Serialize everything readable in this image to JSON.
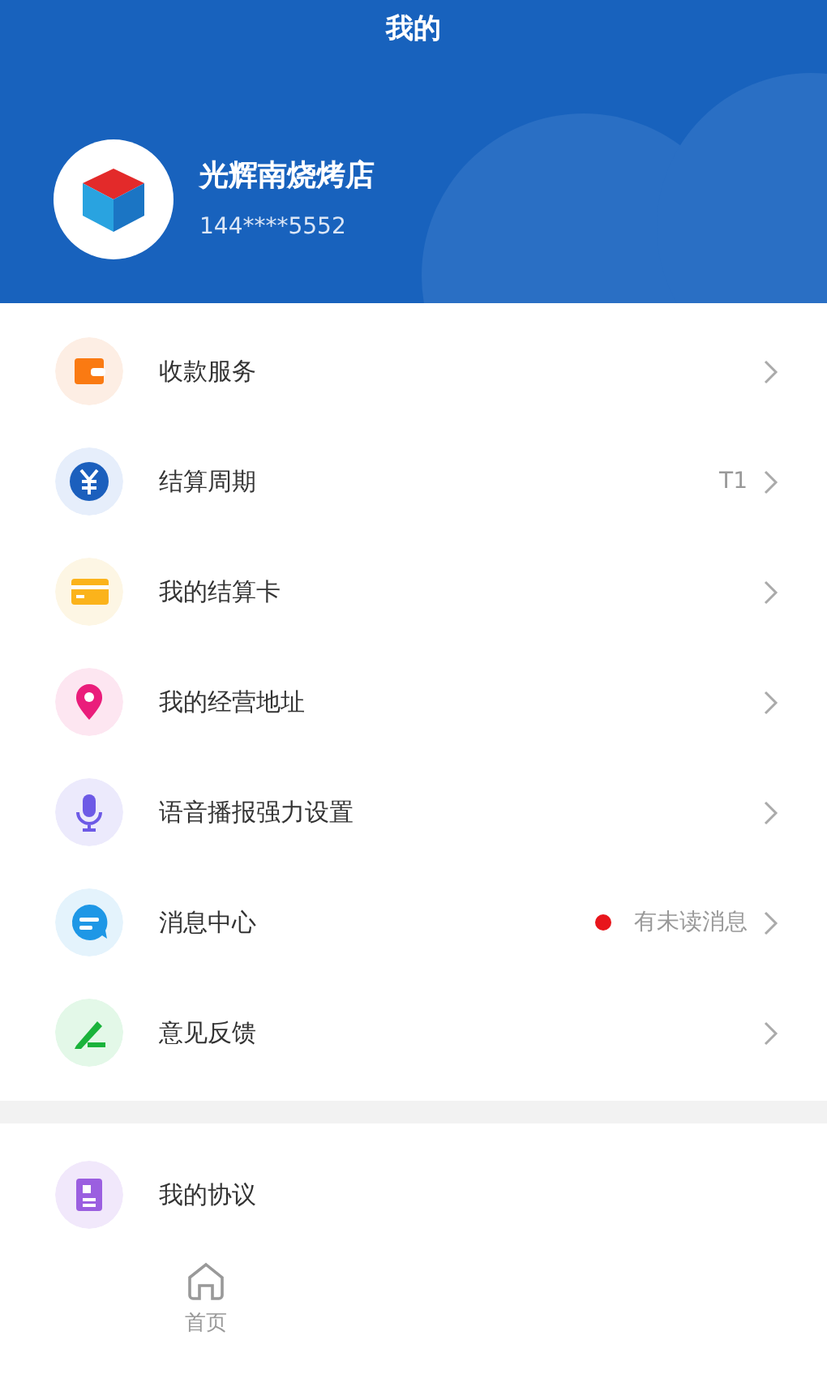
{
  "header": {
    "title": "我的",
    "store_name": "光辉南烧烤店",
    "phone": "144****5552"
  },
  "menu_groups": [
    {
      "items": [
        {
          "label": "收款服务"
        },
        {
          "label": "结算周期",
          "value": "T1"
        },
        {
          "label": "我的结算卡"
        },
        {
          "label": "我的经营地址"
        },
        {
          "label": "语音播报强力设置"
        },
        {
          "label": "消息中心",
          "unread": true,
          "value": "有未读消息"
        },
        {
          "label": "意见反馈"
        }
      ]
    },
    {
      "items": [
        {
          "label": "我的协议"
        }
      ]
    }
  ],
  "tab_bar": [
    {
      "label": "首页",
      "selected": false
    }
  ]
}
